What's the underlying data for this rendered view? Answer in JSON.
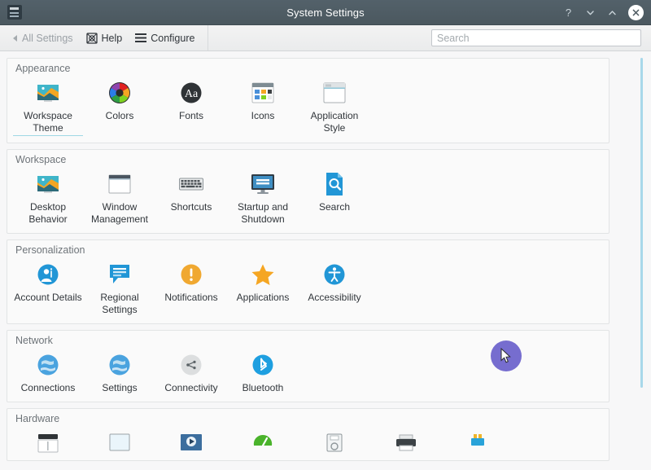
{
  "window": {
    "title": "System Settings",
    "app_icon": "settings-icon",
    "buttons": [
      {
        "name": "help-button",
        "glyph": "?"
      },
      {
        "name": "minimize-button",
        "glyph": "chevron-down-icon"
      },
      {
        "name": "maximize-button",
        "glyph": "chevron-up-icon"
      },
      {
        "name": "close-button",
        "glyph": "close-icon"
      }
    ]
  },
  "toolbar": {
    "all_settings_label": "All Settings",
    "all_settings_enabled": false,
    "help_label": "Help",
    "configure_label": "Configure"
  },
  "search": {
    "value": "",
    "placeholder": "Search"
  },
  "colors": {
    "titlebar": "#4d5b63",
    "accent_hover_underline": "#9fd8e4",
    "scrollbar": "#a8d8ea",
    "click_indicator": "#6359c8",
    "section_bg": "#fafafa",
    "content_bg": "#f7f7f8"
  },
  "sections": [
    {
      "title": "Appearance",
      "items": [
        {
          "label": "Workspace Theme",
          "icon": "workspace-theme-icon",
          "hovered": true
        },
        {
          "label": "Colors",
          "icon": "colors-wheel-icon",
          "hovered": false
        },
        {
          "label": "Fonts",
          "icon": "fonts-icon",
          "hovered": false
        },
        {
          "label": "Icons",
          "icon": "icons-icon",
          "hovered": false
        },
        {
          "label": "Application Style",
          "icon": "application-style-icon",
          "hovered": false
        }
      ]
    },
    {
      "title": "Workspace",
      "items": [
        {
          "label": "Desktop Behavior",
          "icon": "desktop-behavior-icon",
          "hovered": false
        },
        {
          "label": "Window Management",
          "icon": "window-management-icon",
          "hovered": false
        },
        {
          "label": "Shortcuts",
          "icon": "shortcuts-keyboard-icon",
          "hovered": false
        },
        {
          "label": "Startup and Shutdown",
          "icon": "startup-shutdown-icon",
          "hovered": false
        },
        {
          "label": "Search",
          "icon": "search-document-icon",
          "hovered": false
        }
      ]
    },
    {
      "title": "Personalization",
      "items": [
        {
          "label": "Account Details",
          "icon": "account-details-icon",
          "hovered": false
        },
        {
          "label": "Regional Settings",
          "icon": "regional-settings-icon",
          "hovered": false
        },
        {
          "label": "Notifications",
          "icon": "notifications-icon",
          "hovered": false
        },
        {
          "label": "Applications",
          "icon": "applications-star-icon",
          "hovered": false
        },
        {
          "label": "Accessibility",
          "icon": "accessibility-icon",
          "hovered": false
        }
      ]
    },
    {
      "title": "Network",
      "items": [
        {
          "label": "Connections",
          "icon": "network-connections-icon",
          "hovered": false
        },
        {
          "label": "Settings",
          "icon": "network-settings-icon",
          "hovered": false
        },
        {
          "label": "Connectivity",
          "icon": "connectivity-icon",
          "hovered": false
        },
        {
          "label": "Bluetooth",
          "icon": "bluetooth-icon",
          "hovered": false
        }
      ]
    },
    {
      "title": "Hardware",
      "items": [
        {
          "label": "",
          "icon": "input-devices-icon",
          "hovered": false
        },
        {
          "label": "",
          "icon": "display-monitor-icon",
          "hovered": false
        },
        {
          "label": "",
          "icon": "multimedia-icon",
          "hovered": false
        },
        {
          "label": "",
          "icon": "power-management-icon",
          "hovered": false
        },
        {
          "label": "",
          "icon": "removable-storage-icon",
          "hovered": false
        },
        {
          "label": "",
          "icon": "printer-icon",
          "hovered": false
        },
        {
          "label": "",
          "icon": "removable-devices-icon",
          "hovered": false
        }
      ]
    }
  ]
}
